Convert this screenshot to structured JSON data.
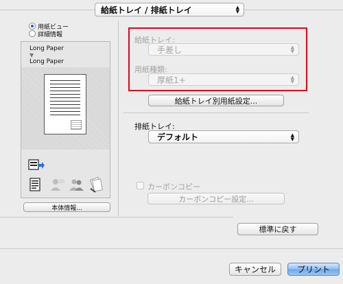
{
  "header": {
    "section_popup": "給紙トレイ / 排紙トレイ"
  },
  "preview": {
    "view_options": [
      {
        "label": "用紙ビュー",
        "selected": true
      },
      {
        "label": "詳細情報",
        "selected": false
      }
    ],
    "paper_top": "Long Paper",
    "paper_bottom": "Long Paper",
    "device_info_button": "本体情報..."
  },
  "paper_tray": {
    "label": "給紙トレイ:",
    "value": "手差し"
  },
  "paper_type": {
    "label": "用紙種類:",
    "value": "厚紙1+"
  },
  "tray_paper_settings_button": "給紙トレイ別用紙設定...",
  "output_tray": {
    "label": "排紙トレイ:",
    "value": "デフォルト"
  },
  "carbon_copy": {
    "checkbox_label": "カーボンコピー",
    "settings_button": "カーボンコピー設定..."
  },
  "restore_defaults_button": "標準に戻す",
  "footer": {
    "cancel_button": "キャンセル",
    "print_button": "プリント"
  },
  "colors": {
    "highlight": "#e3001b",
    "primary_button": "#6aa6ee"
  }
}
